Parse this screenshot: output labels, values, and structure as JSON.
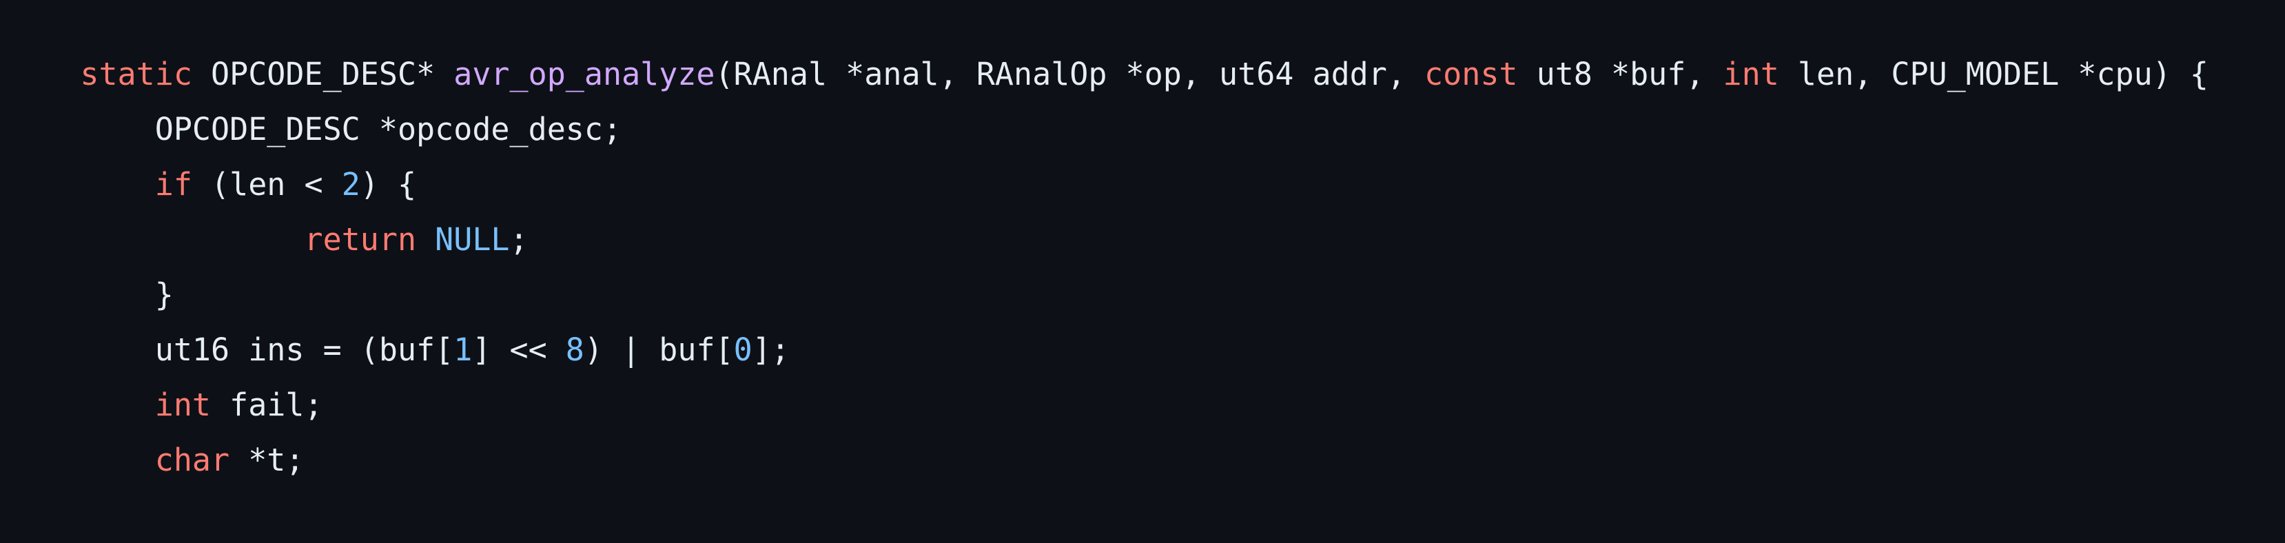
{
  "colors": {
    "background": "#0d1117",
    "text": "#e6edf3",
    "keyword": "#ff7b72",
    "function": "#d2a8ff",
    "number": "#79c0ff"
  },
  "code": {
    "lines": [
      {
        "tokens": [
          {
            "text": "static",
            "kind": "keyword"
          },
          {
            "text": " OPCODE_DESC* ",
            "kind": "plain"
          },
          {
            "text": "avr_op_analyze",
            "kind": "function"
          },
          {
            "text": "(RAnal *anal, RAnalOp *op, ut64 addr, ",
            "kind": "plain"
          },
          {
            "text": "const",
            "kind": "keyword"
          },
          {
            "text": " ut8 *buf, ",
            "kind": "plain"
          },
          {
            "text": "int",
            "kind": "keyword"
          },
          {
            "text": " len, CPU_MODEL *cpu) {",
            "kind": "plain"
          }
        ]
      },
      {
        "tokens": [
          {
            "text": "\tOPCODE_DESC *opcode_desc;",
            "kind": "plain"
          }
        ]
      },
      {
        "tokens": [
          {
            "text": "\t",
            "kind": "plain"
          },
          {
            "text": "if",
            "kind": "keyword"
          },
          {
            "text": " (len < ",
            "kind": "plain"
          },
          {
            "text": "2",
            "kind": "number"
          },
          {
            "text": ") {",
            "kind": "plain"
          }
        ]
      },
      {
        "tokens": [
          {
            "text": "\t\t",
            "kind": "plain"
          },
          {
            "text": "return",
            "kind": "keyword"
          },
          {
            "text": " ",
            "kind": "plain"
          },
          {
            "text": "NULL",
            "kind": "number"
          },
          {
            "text": ";",
            "kind": "plain"
          }
        ]
      },
      {
        "tokens": [
          {
            "text": "\t}",
            "kind": "plain"
          }
        ]
      },
      {
        "tokens": [
          {
            "text": "\tut16 ins = (buf[",
            "kind": "plain"
          },
          {
            "text": "1",
            "kind": "number"
          },
          {
            "text": "] << ",
            "kind": "plain"
          },
          {
            "text": "8",
            "kind": "number"
          },
          {
            "text": ") | buf[",
            "kind": "plain"
          },
          {
            "text": "0",
            "kind": "number"
          },
          {
            "text": "];",
            "kind": "plain"
          }
        ]
      },
      {
        "tokens": [
          {
            "text": "\t",
            "kind": "plain"
          },
          {
            "text": "int",
            "kind": "keyword"
          },
          {
            "text": " fail;",
            "kind": "plain"
          }
        ]
      },
      {
        "tokens": [
          {
            "text": "\t",
            "kind": "plain"
          },
          {
            "text": "char",
            "kind": "keyword"
          },
          {
            "text": " *t;",
            "kind": "plain"
          }
        ]
      }
    ]
  }
}
